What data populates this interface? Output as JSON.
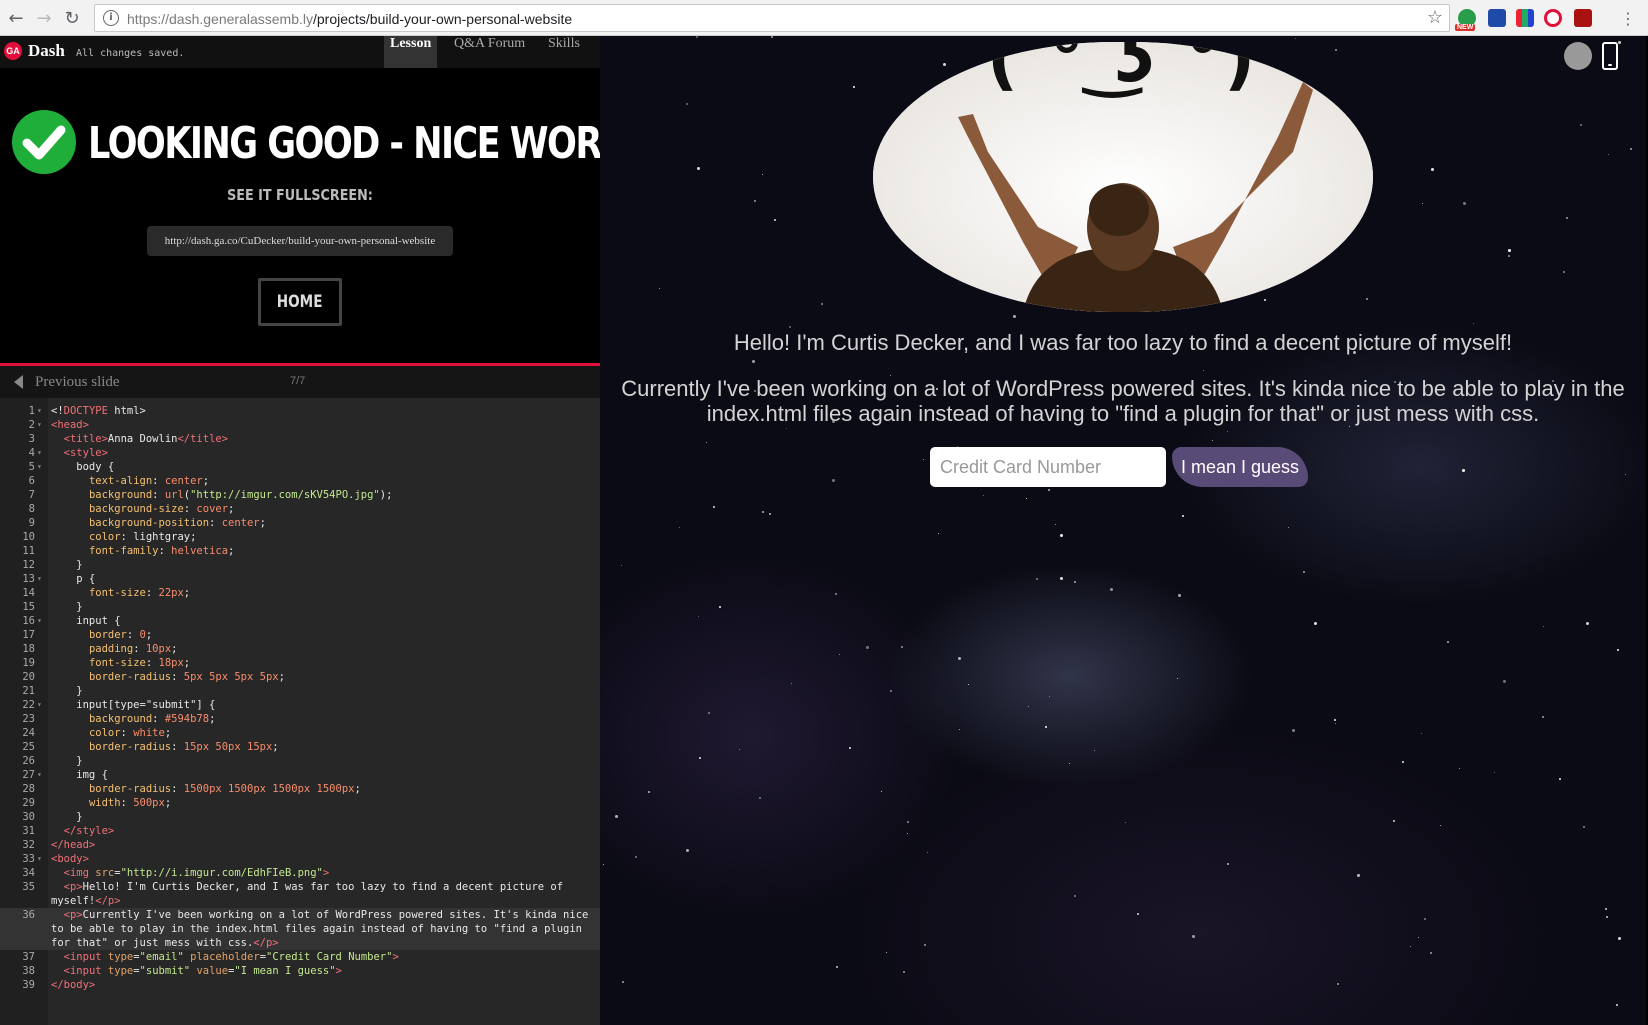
{
  "browser": {
    "url_host": "https://dash.generalassemb.ly",
    "url_path": "/projects/build-your-own-personal-website",
    "extension_badge": "NEW"
  },
  "topnav": {
    "logo": "GA",
    "app_name": "Dash",
    "save_status": "All changes saved.",
    "tabs": [
      "Lesson",
      "Q&A Forum",
      "Skills"
    ],
    "active_tab": "Lesson"
  },
  "lesson": {
    "heading": "LOOKING GOOD - NICE WORK!",
    "see_fullscreen": "SEE IT FULLSCREEN:",
    "fullscreen_url": "http://dash.ga.co/CuDecker/build-your-own-personal-website",
    "home_label": "HOME",
    "prev_slide": "Previous slide",
    "slide_count": "7/7"
  },
  "editor": {
    "lines": [
      {
        "n": "1",
        "fold": true,
        "html": "&lt;!<span class=\"t\">DOCTYPE</span> html&gt;"
      },
      {
        "n": "2",
        "fold": true,
        "html": "<span class=\"t\">&lt;head&gt;</span>"
      },
      {
        "n": "3",
        "html": "  <span class=\"t\">&lt;title&gt;</span>Anna Dowlin<span class=\"t\">&lt;/title&gt;</span>"
      },
      {
        "n": "4",
        "fold": true,
        "html": "  <span class=\"t\">&lt;style&gt;</span>"
      },
      {
        "n": "5",
        "fold": true,
        "html": "    body {"
      },
      {
        "n": "6",
        "html": "      <span class=\"k\">text-align</span>: <span class=\"v\">center</span>;"
      },
      {
        "n": "7",
        "html": "      <span class=\"k\">background</span>: <span class=\"v\">url</span>(<span class=\"s\">\"http://imgur.com/sKV54PO.jpg\"</span>);"
      },
      {
        "n": "8",
        "html": "      <span class=\"k\">background-size</span>: <span class=\"v\">cover</span>;"
      },
      {
        "n": "9",
        "html": "      <span class=\"k\">background-position</span>: <span class=\"v\">center</span>;"
      },
      {
        "n": "10",
        "html": "      <span class=\"k\">color</span>: lightgray;"
      },
      {
        "n": "11",
        "html": "      <span class=\"k\">font-family</span>: <span class=\"v\">helvetica</span>;"
      },
      {
        "n": "12",
        "html": "    }"
      },
      {
        "n": "13",
        "fold": true,
        "html": "    p {"
      },
      {
        "n": "14",
        "html": "      <span class=\"k\">font-size</span>: <span class=\"v\">22px</span>;"
      },
      {
        "n": "15",
        "html": "    }"
      },
      {
        "n": "16",
        "fold": true,
        "html": "    input {"
      },
      {
        "n": "17",
        "html": "      <span class=\"k\">border</span>: <span class=\"v\">0</span>;"
      },
      {
        "n": "18",
        "html": "      <span class=\"k\">padding</span>: <span class=\"v\">10px</span>;"
      },
      {
        "n": "19",
        "html": "      <span class=\"k\">font-size</span>: <span class=\"v\">18px</span>;"
      },
      {
        "n": "20",
        "html": "      <span class=\"k\">border-radius</span>: <span class=\"v\">5px 5px 5px 5px</span>;"
      },
      {
        "n": "21",
        "html": "    }"
      },
      {
        "n": "22",
        "fold": true,
        "html": "    input[type=\"submit\"] {"
      },
      {
        "n": "23",
        "html": "      <span class=\"k\">background</span>: <span class=\"v\">#594b78</span>;"
      },
      {
        "n": "24",
        "html": "      <span class=\"k\">color</span>: <span class=\"v\">white</span>;"
      },
      {
        "n": "25",
        "html": "      <span class=\"k\">border-radius</span>: <span class=\"v\">15px 50px 15px</span>;"
      },
      {
        "n": "26",
        "html": "    }"
      },
      {
        "n": "27",
        "fold": true,
        "html": "    img {"
      },
      {
        "n": "28",
        "html": "      <span class=\"k\">border-radius</span>: <span class=\"v\">1500px 1500px 1500px 1500px</span>;"
      },
      {
        "n": "29",
        "html": "      <span class=\"k\">width</span>: <span class=\"v\">500px</span>;"
      },
      {
        "n": "30",
        "html": "    }"
      },
      {
        "n": "31",
        "html": "  <span class=\"t\">&lt;/style&gt;</span>"
      },
      {
        "n": "32",
        "html": "<span class=\"t\">&lt;/head&gt;</span>"
      },
      {
        "n": "33",
        "fold": true,
        "html": "<span class=\"t\">&lt;body&gt;</span>"
      },
      {
        "n": "34",
        "html": "  <span class=\"t\">&lt;img</span> <span class=\"a\">src</span>=<span class=\"s\">\"http://i.imgur.com/EdhFIeB.png\"</span><span class=\"t\">&gt;</span>"
      },
      {
        "n": "35",
        "wrap": 2,
        "html": "  <span class=\"t\">&lt;p&gt;</span>Hello! I'm Curtis Decker, and I was far too lazy to find a decent picture of myself!<span class=\"t\">&lt;/p&gt;</span>"
      },
      {
        "n": "36",
        "wrap": 3,
        "hl": true,
        "html": "  <span class=\"t\">&lt;p&gt;</span>Currently I've been working on a lot of WordPress powered sites. It's kinda nice to be able to play in the index.html files again instead of having to \"find a plugin for that\" or just mess with css.<span class=\"t\">&lt;/p&gt;</span>"
      },
      {
        "n": "37",
        "html": "  <span class=\"t\">&lt;input</span> <span class=\"a\">type</span>=<span class=\"s\">\"email\"</span> <span class=\"a\">placeholder</span>=<span class=\"s\">\"Credit Card Number\"</span><span class=\"t\">&gt;</span>"
      },
      {
        "n": "38",
        "html": "  <span class=\"t\">&lt;input</span> <span class=\"a\">type</span>=<span class=\"s\">\"submit\"</span> <span class=\"a\">value</span>=<span class=\"s\">\"I mean I guess\"</span><span class=\"t\">&gt;</span>"
      },
      {
        "n": "39",
        "html": "<span class=\"t\">&lt;/body&gt;</span>"
      }
    ]
  },
  "preview": {
    "face_text": "( ͡° ͜ʖ ͡°)",
    "intro": "Hello! I'm Curtis Decker, and I was far too lazy to find a decent picture of myself!",
    "about": "Currently I've been working on a lot of WordPress powered sites. It's kinda nice to be able to play in the index.html files again instead of having to \"find a plugin for that\" or just mess with css.",
    "email_placeholder": "Credit Card Number",
    "submit_label": "I mean I guess",
    "submit_color": "#594b78"
  }
}
